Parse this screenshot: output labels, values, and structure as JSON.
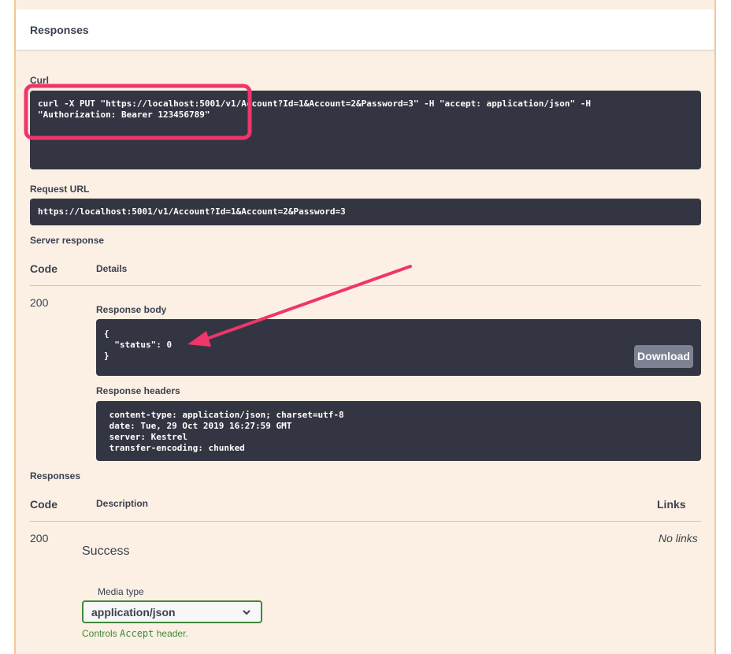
{
  "responses_header": {
    "title": "Responses"
  },
  "curl": {
    "label": "Curl",
    "command": "curl -X PUT \"https://localhost:5001/v1/Account?Id=1&Account=2&Password=3\" -H \"accept: application/json\" -H\n\"Authorization: Bearer 123456789\""
  },
  "request_url": {
    "label": "Request URL",
    "value": "https://localhost:5001/v1/Account?Id=1&Account=2&Password=3"
  },
  "server_response": {
    "label": "Server response",
    "code_header": "Code",
    "details_header": "Details",
    "code": "200",
    "body_label": "Response body",
    "body": "{\n  \"status\": 0\n}",
    "download_label": "Download",
    "headers_label": "Response headers",
    "headers": " content-type: application/json; charset=utf-8\n date: Tue, 29 Oct 2019 16:27:59 GMT\n server: Kestrel\n transfer-encoding: chunked"
  },
  "responses": {
    "label": "Responses",
    "code_header": "Code",
    "description_header": "Description",
    "links_header": "Links",
    "code": "200",
    "description": "Success",
    "links_value": "No links",
    "media_type_label": "Media type",
    "media_type_value": "application/json",
    "controls_prefix": "Controls ",
    "controls_code": "Accept",
    "controls_suffix": " header."
  },
  "colors": {
    "panel_bg": "#fbf0e3",
    "panel_border": "#f4c896",
    "code_bg": "#333642",
    "highlight": "#f0356b",
    "select_border": "#41883a"
  }
}
